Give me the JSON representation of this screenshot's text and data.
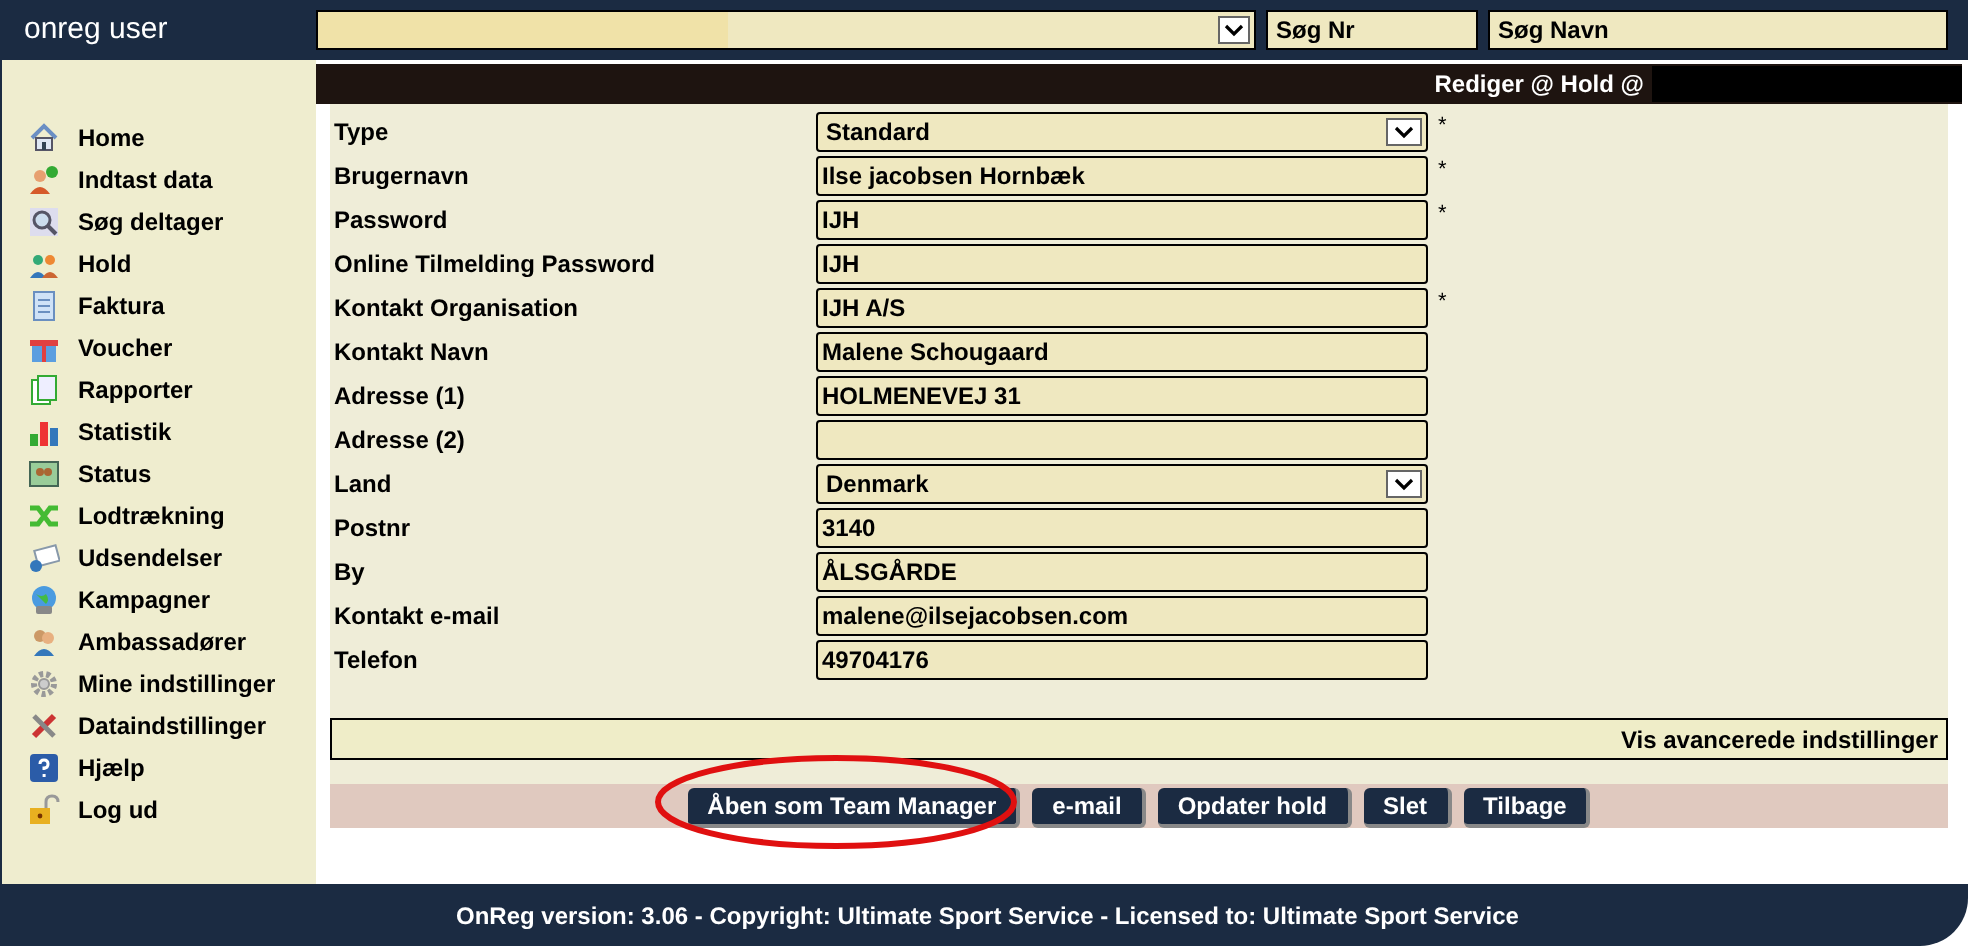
{
  "app_title": "onreg user",
  "search_number": {
    "value": "Søg Nr"
  },
  "search_name": {
    "value": "Søg Navn"
  },
  "sidebar": {
    "items": [
      {
        "label": "Home"
      },
      {
        "label": "Indtast data"
      },
      {
        "label": "Søg deltager"
      },
      {
        "label": "Hold"
      },
      {
        "label": "Faktura"
      },
      {
        "label": "Voucher"
      },
      {
        "label": "Rapporter"
      },
      {
        "label": "Statistik"
      },
      {
        "label": "Status"
      },
      {
        "label": "Lodtrækning"
      },
      {
        "label": "Udsendelser"
      },
      {
        "label": "Kampagner"
      },
      {
        "label": "Ambassadører"
      },
      {
        "label": "Mine indstillinger"
      },
      {
        "label": "Dataindstillinger"
      },
      {
        "label": "Hjælp"
      },
      {
        "label": "Log ud"
      }
    ]
  },
  "page_title": "Rediger @ Hold @",
  "form": {
    "fields": [
      {
        "label": "Type",
        "kind": "select",
        "value": "Standard",
        "required_mark": "*"
      },
      {
        "label": "Brugernavn",
        "kind": "text",
        "value": "Ilse jacobsen Hornbæk",
        "required_mark": "*"
      },
      {
        "label": "Password",
        "kind": "text",
        "value": "IJH",
        "required_mark": "*"
      },
      {
        "label": "Online Tilmelding Password",
        "kind": "text",
        "value": "IJH"
      },
      {
        "label": "Kontakt Organisation",
        "kind": "text",
        "value": "IJH A/S",
        "required_mark": "*"
      },
      {
        "label": "Kontakt Navn",
        "kind": "text",
        "value": "Malene Schougaard"
      },
      {
        "label": "Adresse (1)",
        "kind": "text",
        "value": "HOLMENEVEJ 31"
      },
      {
        "label": "Adresse (2)",
        "kind": "text"
      },
      {
        "label": "Land",
        "kind": "select",
        "value": "Denmark"
      },
      {
        "label": "Postnr",
        "kind": "text",
        "value": "3140"
      },
      {
        "label": "By",
        "kind": "text",
        "value": "ÅLSGÅRDE"
      },
      {
        "label": "Kontakt e-mail",
        "kind": "text",
        "value": "malene@ilsejacobsen.com"
      },
      {
        "label": "Telefon",
        "kind": "text",
        "value": "49704176"
      }
    ]
  },
  "advanced_link": "Vis avancerede indstillinger",
  "buttons": [
    {
      "label": "Åben som Team Manager",
      "highlighted": true
    },
    {
      "label": "e-mail",
      "highlighted": false
    },
    {
      "label": "Opdater hold",
      "highlighted": false
    },
    {
      "label": "Slet",
      "highlighted": false
    },
    {
      "label": "Tilbage",
      "highlighted": false
    }
  ],
  "footer": "OnReg version: 3.06 - Copyright: Ultimate Sport Service - Licensed to: Ultimate Sport Service"
}
